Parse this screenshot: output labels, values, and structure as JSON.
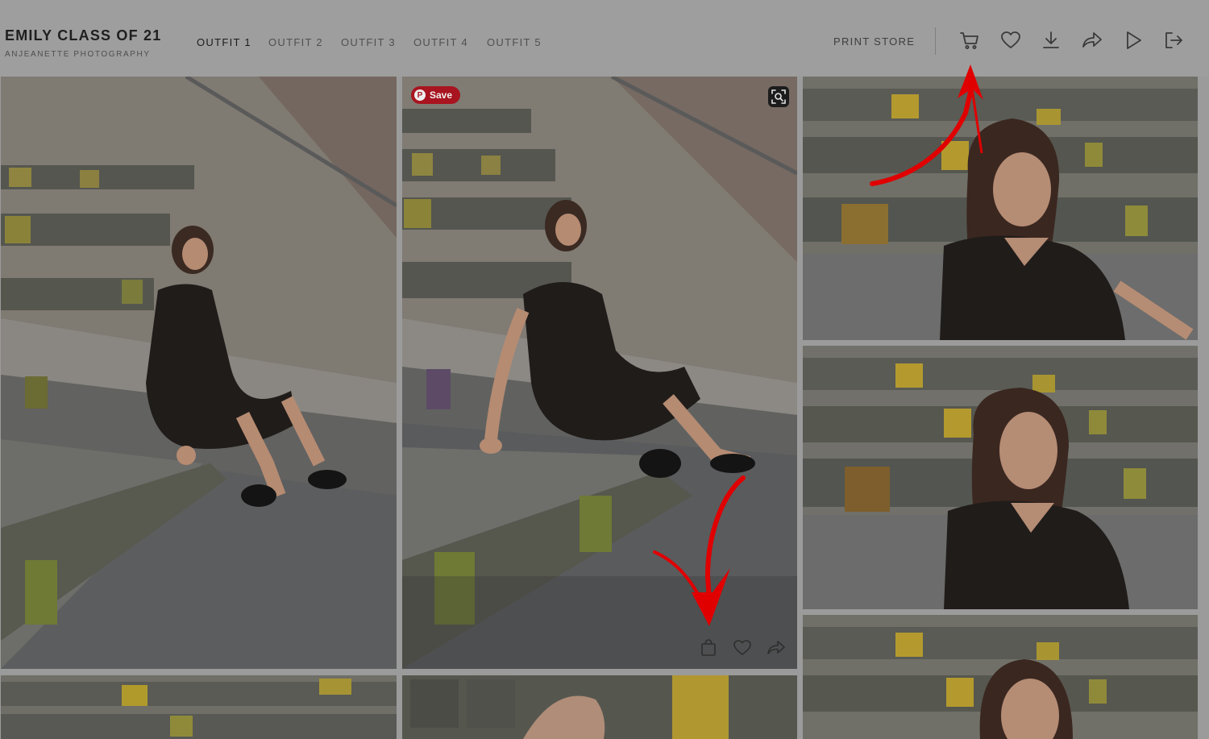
{
  "gallery": {
    "title": "EMILY CLASS OF 21",
    "subtitle": "ANJEANETTE PHOTOGRAPHY"
  },
  "nav": {
    "items": [
      "OUTFIT 1",
      "OUTFIT 2",
      "OUTFIT 3",
      "OUTFIT 4",
      "OUTFIT 5"
    ],
    "active_index": 0
  },
  "header_actions": {
    "print_store": "PRINT STORE",
    "icons": [
      "cart-icon",
      "heart-icon",
      "download-icon",
      "share-icon",
      "slideshow-play-icon",
      "exit-icon"
    ]
  },
  "photo_overlay": {
    "pinterest_label": "Save",
    "actions": [
      "shopping-bag-icon",
      "heart-icon",
      "share-icon"
    ]
  },
  "colors": {
    "arrow": "#e00000",
    "pinterest": "#a8141f",
    "text_dark": "#1f1f1f"
  }
}
